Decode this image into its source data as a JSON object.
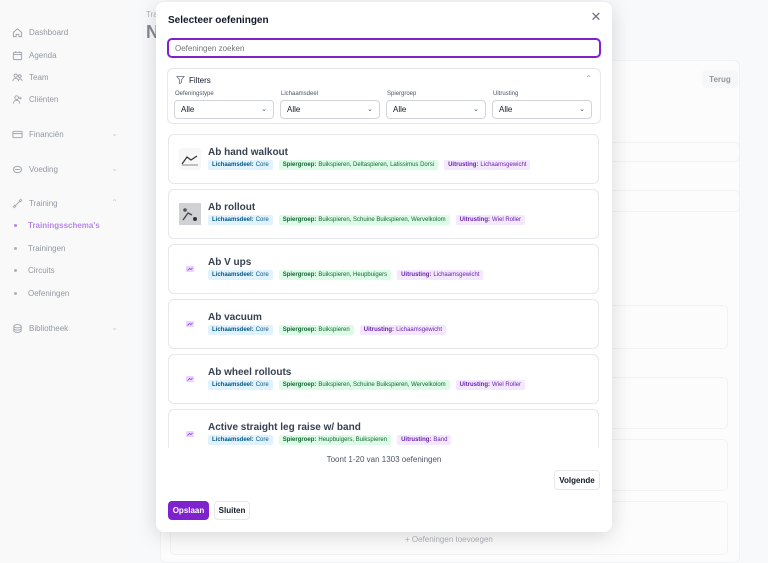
{
  "sidebar": {
    "items": [
      {
        "label": "Dashboard",
        "icon": "home-icon"
      },
      {
        "label": "Agenda",
        "icon": "calendar-icon"
      },
      {
        "label": "Team",
        "icon": "team-icon"
      },
      {
        "label": "Cliënten",
        "icon": "users-icon"
      },
      {
        "label": "Financiën",
        "icon": "card-icon"
      },
      {
        "label": "Voeding",
        "icon": "food-icon"
      },
      {
        "label": "Training",
        "icon": "dumbbell-icon"
      },
      {
        "label": "Bibliotheek",
        "icon": "library-icon"
      }
    ],
    "training_sub": [
      {
        "label": "Trainingsschema's",
        "active": true
      },
      {
        "label": "Trainingen",
        "active": false
      },
      {
        "label": "Circuits",
        "active": false
      },
      {
        "label": "Oefeningen",
        "active": false
      }
    ]
  },
  "background": {
    "breadcrumb": "Tra",
    "title": "N",
    "back_label": "Terug",
    "add_exercises": "+ Oefeningen toevoegen"
  },
  "modal": {
    "title": "Selecteer oefeningen",
    "search_placeholder": "Oefeningen zoeken",
    "filters_label": "Filters",
    "filters": [
      {
        "label": "Oefeningstype",
        "value": "Alle"
      },
      {
        "label": "Lichaamsdeel",
        "value": "Alle"
      },
      {
        "label": "Spiergroep",
        "value": "Alle"
      },
      {
        "label": "Uitrusting",
        "value": "Alle"
      }
    ],
    "exercises": [
      {
        "name": "Ab hand walkout",
        "body": "Core",
        "muscles": "Buikspieren, Deltaspieren, Latissimus Dorsi",
        "equipment": "Lichaamsgewicht",
        "thumb": "photo"
      },
      {
        "name": "Ab rollout",
        "body": "Core",
        "muscles": "Buikspieren, Schuine Buikspieren, Wervelkolom",
        "equipment": "Wiel Roller",
        "thumb": "photo"
      },
      {
        "name": "Ab V ups",
        "body": "Core",
        "muscles": "Buikspieren, Heupbuigers",
        "equipment": "Lichaamsgewicht",
        "thumb": "placeholder"
      },
      {
        "name": "Ab vacuum",
        "body": "Core",
        "muscles": "Buikspieren",
        "equipment": "Lichaamsgewicht",
        "thumb": "placeholder"
      },
      {
        "name": "Ab wheel rollouts",
        "body": "Core",
        "muscles": "Buikspieren, Schuine Buikspieren, Wervelkolom",
        "equipment": "Wiel Roller",
        "thumb": "placeholder"
      },
      {
        "name": "Active straight leg raise w/ band",
        "body": "Core",
        "muscles": "Heupbuigers, Buikspieren",
        "equipment": "Band",
        "thumb": "placeholder"
      }
    ],
    "tag_labels": {
      "body": "Lichaamsdeel:",
      "muscles": "Spiergroep:",
      "equipment": "Uitrusting:"
    },
    "result_text": "Toont 1-20 van 1303 oefeningen",
    "next_label": "Volgende",
    "save_label": "Opslaan",
    "close_label": "Sluiten"
  },
  "colors": {
    "accent": "#7e22ce"
  }
}
